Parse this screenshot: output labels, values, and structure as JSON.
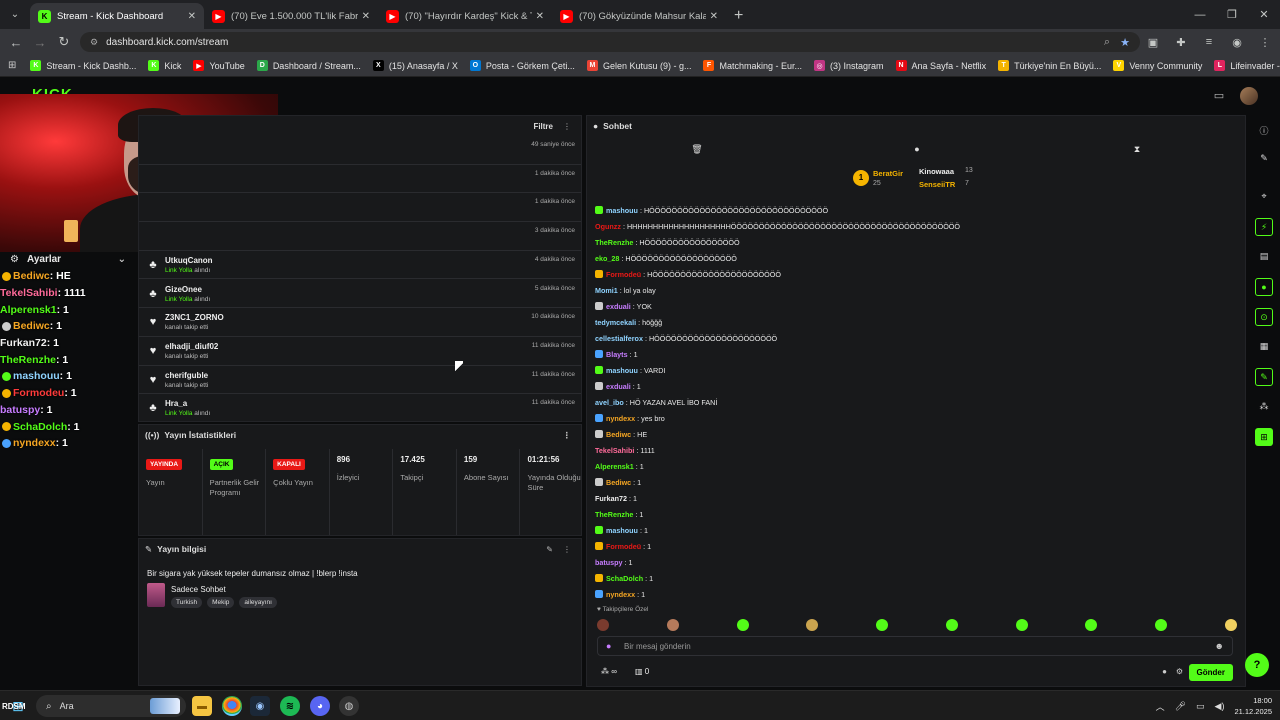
{
  "browser": {
    "tabs": [
      {
        "title": "Stream - Kick Dashboard",
        "favicon": "kick",
        "active": true
      },
      {
        "title": "(70) Eve 1.500.000 TL'lik Fabrika",
        "favicon": "youtube",
        "active": false
      },
      {
        "title": "(70) \"Hayırdır Kardeş\" Kick & Tw",
        "favicon": "youtube",
        "active": false
      },
      {
        "title": "(70) Gökyüzünde Mahsur Kalan",
        "favicon": "youtube",
        "active": false
      }
    ],
    "url": "dashboard.kick.com/stream",
    "bookmarks": [
      {
        "label": "Stream - Kick Dashb...",
        "color": "#53fc18",
        "glyph": "K"
      },
      {
        "label": "Kick",
        "color": "#53fc18",
        "glyph": "K"
      },
      {
        "label": "YouTube",
        "color": "#ff0000",
        "glyph": "▶"
      },
      {
        "label": "Dashboard / Stream...",
        "color": "#2ba84a",
        "glyph": "D"
      },
      {
        "label": "(15) Anasayfa / X",
        "color": "#000000",
        "glyph": "X"
      },
      {
        "label": "Posta - Görkem Çeti...",
        "color": "#0078d4",
        "glyph": "O"
      },
      {
        "label": "Gelen Kutusu (9) - g...",
        "color": "#ea4335",
        "glyph": "M"
      },
      {
        "label": "Matchmaking - Eur...",
        "color": "#ff5500",
        "glyph": "F"
      },
      {
        "label": "(3) Instagram",
        "color": "#c13584",
        "glyph": "◎"
      },
      {
        "label": "Ana Sayfa - Netflix",
        "color": "#e50914",
        "glyph": "N"
      },
      {
        "label": "Türkiye'nin En Büyü...",
        "color": "#f5b400",
        "glyph": "T"
      },
      {
        "label": "Venny Community",
        "color": "#ffd400",
        "glyph": "V"
      },
      {
        "label": "Lifeinvader - VennyV",
        "color": "#e0245e",
        "glyph": "L"
      }
    ]
  },
  "sidebar": {
    "settings_label": "Ayarlar"
  },
  "overlay_chat": [
    {
      "user": "Bediwc",
      "text": ": HE",
      "color": "#f5a623",
      "badge": "#f5b400"
    },
    {
      "user": "TekelSahibi",
      "text": ": 1111",
      "color": "#ff6b9a",
      "badge": ""
    },
    {
      "user": "Alperensk1",
      "text": ": 1",
      "color": "#53fc18",
      "badge": ""
    },
    {
      "user": "Bediwc",
      "text": ": 1",
      "color": "#f5a623",
      "badge": "#ccc"
    },
    {
      "user": "Furkan72",
      "text": ": 1",
      "color": "#f0f0f0",
      "badge": ""
    },
    {
      "user": "TheRenzhe",
      "text": ": 1",
      "color": "#53fc18",
      "badge": ""
    },
    {
      "user": "mashouu",
      "text": ": 1",
      "color": "#8fd3ff",
      "badge": "#53fc18"
    },
    {
      "user": "Formodeu",
      "text": ": 1",
      "color": "#ff3b3b",
      "badge": "#f5b400"
    },
    {
      "user": "batuspy",
      "text": ": 1",
      "color": "#c77dff",
      "badge": ""
    },
    {
      "user": "SchaDolch",
      "text": ": 1",
      "color": "#53fc18",
      "badge": "#f5b400"
    },
    {
      "user": "nyndexx",
      "text": ": 1",
      "color": "#f5a623",
      "badge": "#4aa3ff"
    }
  ],
  "activity": {
    "filter_label": "Filtre",
    "events": [
      {
        "name": "",
        "action": "",
        "time": "49 saniye önce",
        "icon": "none"
      },
      {
        "name": "",
        "action": "",
        "time": "1 dakika önce",
        "icon": "none"
      },
      {
        "name": "",
        "action": "",
        "time": "1 dakika önce",
        "icon": "none"
      },
      {
        "name": "",
        "action": "",
        "time": "3 dakika önce",
        "icon": "none"
      },
      {
        "name": "UtkuqCanon",
        "action_green": "Link Yolla",
        "action": " alındı",
        "time": "4 dakika önce",
        "icon": "♣"
      },
      {
        "name": "GizeOnee",
        "action_green": "Link Yolla",
        "action": " alındı",
        "time": "5 dakika önce",
        "icon": "♣"
      },
      {
        "name": "Z3NC1_ZORNO",
        "action_green": "",
        "action": "kanalı takip etti",
        "time": "10 dakika önce",
        "icon": "♥"
      },
      {
        "name": "elhadji_diuf02",
        "action_green": "",
        "action": "kanalı takip etti",
        "time": "11 dakika önce",
        "icon": "♥"
      },
      {
        "name": "cherifguble",
        "action_green": "",
        "action": "kanalı takip etti",
        "time": "11 dakika önce",
        "icon": "♥"
      },
      {
        "name": "Hra_a",
        "action_green": "Link Yolla",
        "action": " alındı",
        "time": "11 dakika önce",
        "icon": "♣"
      }
    ]
  },
  "stats": {
    "title": "Yayın İstatistikleri",
    "items": [
      {
        "badge": "YAYINDA",
        "badge_color": "#e91916",
        "badge_text_color": "#ffffff",
        "value": "",
        "label": "Yayın"
      },
      {
        "badge": "AÇIK",
        "badge_color": "#53fc18",
        "badge_text_color": "#000000",
        "value": "",
        "label": "Partnerlik Gelir Programı"
      },
      {
        "badge": "KAPALI",
        "badge_color": "#e91916",
        "badge_text_color": "#ffffff",
        "value": "",
        "label": "Çoklu Yayın"
      },
      {
        "badge": "",
        "value": "896",
        "label": "İzleyici"
      },
      {
        "badge": "",
        "value": "17.425",
        "label": "Takipçi"
      },
      {
        "badge": "",
        "value": "159",
        "label": "Abone Sayısı"
      },
      {
        "badge": "",
        "value": "01:21:56",
        "label": "Yayında Olduğu Süre"
      }
    ]
  },
  "stream_info": {
    "title": "Yayın bilgisi",
    "stream_title": "Bir sigara yak yüksek tepeler dumansız olmaz | !blerp !insta",
    "category": "Sadece Sohbet",
    "tags": [
      "Turkish",
      "Mekip",
      "aileyayını"
    ]
  },
  "chat": {
    "title": "Sohbet",
    "leaderboard": {
      "first": {
        "rank": "1",
        "name": "BeratGir",
        "count": "25"
      },
      "second": {
        "name": "Kinowaaa",
        "count": "13"
      },
      "third": {
        "name": "SenseiiTR",
        "count": "7"
      }
    },
    "messages": [
      {
        "user": "mashouu",
        "text": ": HÖÖÖÖÖÖÖÖÖÖÖÖÖÖÖÖÖÖÖÖÖÖÖÖÖÖÖÖÖÖÖÖ",
        "color": "#8fd3ff",
        "badge": "#53fc18"
      },
      {
        "user": "Ogunzz",
        "text": ": HHHHHHHHHHHHHHHHHHHHÖÖÖÖÖÖÖÖÖÖÖÖÖÖÖÖÖÖÖÖÖÖÖÖÖÖÖÖÖÖÖÖÖÖÖÖÖÖÖÖÖ",
        "color": "#e91916",
        "badge": ""
      },
      {
        "user": "TheRenzhe",
        "text": ": HÖÖÖÖÖÖÖÖÖÖÖÖÖÖÖÖÖ",
        "color": "#53fc18",
        "badge": ""
      },
      {
        "user": "eko_28",
        "text": ": HÖÖÖÖÖÖÖÖÖÖÖÖÖÖÖÖÖÖÖ",
        "color": "#53fc18",
        "badge": ""
      },
      {
        "user": "Formodeü",
        "text": ": HÖÖÖÖÖÖÖÖÖÖÖÖÖÖÖÖÖÖÖÖÖÖÖ",
        "color": "#e91916",
        "badge": "#f5b400"
      },
      {
        "user": "Momi1",
        "text": ": lol ya olay",
        "color": "#8fd3ff",
        "badge": ""
      },
      {
        "user": "exduali",
        "text": ": YOK",
        "color": "#c77dff",
        "badge": "#ccc"
      },
      {
        "user": "tedymcekali",
        "text": ": höğğğ",
        "color": "#8fd3ff",
        "badge": ""
      },
      {
        "user": "cellestialferox",
        "text": ": HÖÖÖÖÖÖÖÖÖÖÖÖÖÖÖÖÖÖÖÖÖÖ",
        "color": "#8fd3ff",
        "badge": ""
      },
      {
        "user": "Blayts",
        "text": ": 1",
        "color": "#c77dff",
        "badge": "#4aa3ff"
      },
      {
        "user": "mashouu",
        "text": ": VARDI",
        "color": "#8fd3ff",
        "badge": "#53fc18"
      },
      {
        "user": "exduali",
        "text": ": 1",
        "color": "#c77dff",
        "badge": "#ccc"
      },
      {
        "user": "avel_ibo",
        "text": ": HÖ YAZAN AVEL İBO FANİ",
        "color": "#8fd3ff",
        "badge": ""
      },
      {
        "user": "nyndexx",
        "text": ": yes bro",
        "color": "#f5a623",
        "badge": "#4aa3ff"
      },
      {
        "user": "Bediwc",
        "text": ": HE",
        "color": "#f5a623",
        "badge": "#ccc"
      },
      {
        "user": "TekelSahibi",
        "text": ": 1111",
        "color": "#ff6b9a",
        "badge": ""
      },
      {
        "user": "Alperensk1",
        "text": ": 1",
        "color": "#53fc18",
        "badge": ""
      },
      {
        "user": "Bediwc",
        "text": ": 1",
        "color": "#f5a623",
        "badge": "#ccc"
      },
      {
        "user": "Furkan72",
        "text": ": 1",
        "color": "#f0f0f0",
        "badge": ""
      },
      {
        "user": "TheRenzhe",
        "text": ": 1",
        "color": "#53fc18",
        "badge": ""
      },
      {
        "user": "mashouu",
        "text": ": 1",
        "color": "#8fd3ff",
        "badge": "#53fc18"
      },
      {
        "user": "Formodeü",
        "text": ": 1",
        "color": "#e91916",
        "badge": "#f5b400"
      },
      {
        "user": "batuspy",
        "text": ": 1",
        "color": "#c77dff",
        "badge": ""
      },
      {
        "user": "SchaDolch",
        "text": ": 1",
        "color": "#53fc18",
        "badge": "#f5b400"
      },
      {
        "user": "nyndexx",
        "text": ": 1",
        "color": "#f5a623",
        "badge": "#4aa3ff"
      }
    ],
    "followers_only_label": "Takipçilere Özel",
    "emote_colors": [
      "#7a3b2e",
      "#b57a5b",
      "#53fc18",
      "#caa44f",
      "#53fc18",
      "#53fc18",
      "#53fc18",
      "#53fc18",
      "#53fc18",
      "#f0d060"
    ],
    "input_placeholder": "Bir mesaj gönderin",
    "points_value": "0",
    "send_label": "Gönder"
  },
  "taskbar": {
    "search_label": "Ara",
    "time": "18:00",
    "date": "21.12.2025",
    "corner_text": "RDSM"
  },
  "colors": {
    "accent": "#53fc18",
    "live_red": "#e91916"
  }
}
